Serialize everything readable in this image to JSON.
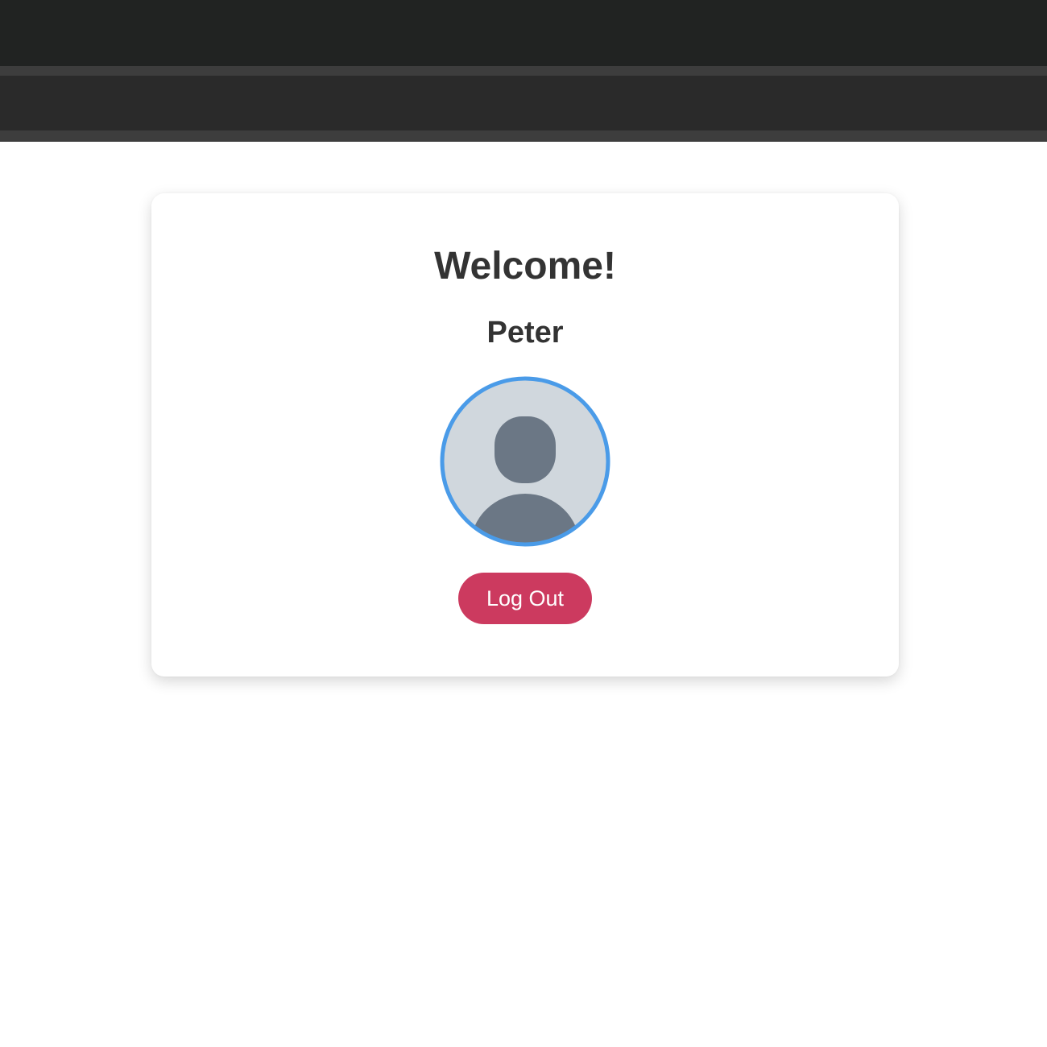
{
  "header": {
    "background": "#212322",
    "nav_background": "#2a2a2a"
  },
  "profile": {
    "welcome": "Welcome!",
    "name": "Peter",
    "avatar_icon": "default-user-avatar-icon",
    "avatar_ring_color": "#4a9be8"
  },
  "actions": {
    "logout_label": "Log Out",
    "logout_color": "#cc3a5f"
  }
}
